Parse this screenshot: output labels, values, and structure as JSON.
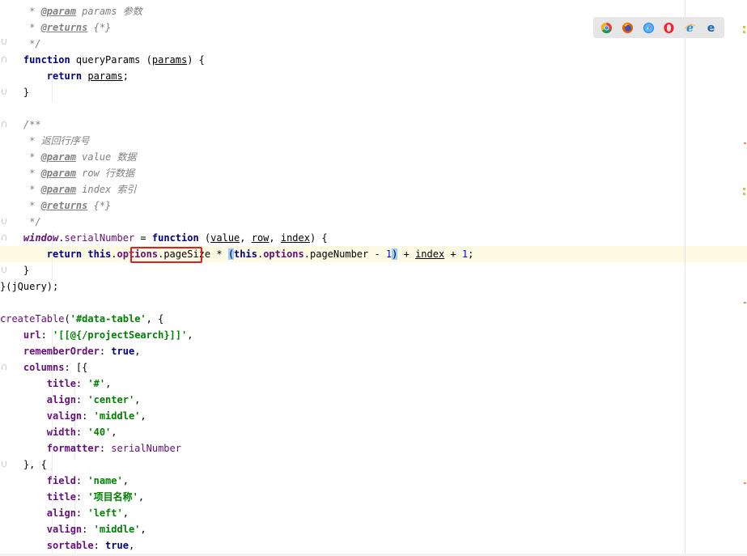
{
  "editor": {
    "lines": [
      [
        {
          "t": "     "
        },
        {
          "t": "* ",
          "c": "cmt"
        },
        {
          "t": "@param",
          "c": "tag"
        },
        {
          "t": " params 参数",
          "c": "cmt"
        }
      ],
      [
        {
          "t": "     "
        },
        {
          "t": "* ",
          "c": "cmt"
        },
        {
          "t": "@returns",
          "c": "tag"
        },
        {
          "t": " {*}",
          "c": "cmt"
        }
      ],
      [
        {
          "t": "     "
        },
        {
          "t": "*/",
          "c": "cmt"
        }
      ],
      [
        {
          "t": "    "
        },
        {
          "t": "function",
          "c": "kw"
        },
        {
          "t": " queryParams (",
          "c": "fn"
        },
        {
          "t": "params",
          "c": "ul"
        },
        {
          "t": ") {"
        }
      ],
      [
        {
          "t": "        "
        },
        {
          "t": "return",
          "c": "kw"
        },
        {
          "t": " "
        },
        {
          "t": "params",
          "c": "ul"
        },
        {
          "t": ";"
        }
      ],
      [
        {
          "t": "    }"
        }
      ],
      [
        {
          "t": ""
        }
      ],
      [
        {
          "t": "    "
        },
        {
          "t": "/**",
          "c": "cmt"
        }
      ],
      [
        {
          "t": "     "
        },
        {
          "t": "* 返回行序号",
          "c": "cmt"
        }
      ],
      [
        {
          "t": "     "
        },
        {
          "t": "* ",
          "c": "cmt"
        },
        {
          "t": "@param",
          "c": "tag"
        },
        {
          "t": " value 数据",
          "c": "cmt"
        }
      ],
      [
        {
          "t": "     "
        },
        {
          "t": "* ",
          "c": "cmt"
        },
        {
          "t": "@param",
          "c": "tag"
        },
        {
          "t": " row 行数据",
          "c": "cmt"
        }
      ],
      [
        {
          "t": "     "
        },
        {
          "t": "* ",
          "c": "cmt"
        },
        {
          "t": "@param",
          "c": "tag"
        },
        {
          "t": " index 索引",
          "c": "cmt"
        }
      ],
      [
        {
          "t": "     "
        },
        {
          "t": "* ",
          "c": "cmt"
        },
        {
          "t": "@returns",
          "c": "tag"
        },
        {
          "t": " {*}",
          "c": "cmt"
        }
      ],
      [
        {
          "t": "     "
        },
        {
          "t": "*/",
          "c": "cmt"
        }
      ],
      [
        {
          "t": "    "
        },
        {
          "t": "window",
          "c": "win"
        },
        {
          "t": "."
        },
        {
          "t": "serialNumber",
          "c": "globl"
        },
        {
          "t": " = "
        },
        {
          "t": "function",
          "c": "kw"
        },
        {
          "t": " ("
        },
        {
          "t": "value",
          "c": "ul"
        },
        {
          "t": ", "
        },
        {
          "t": "row",
          "c": "ul"
        },
        {
          "t": ", "
        },
        {
          "t": "index",
          "c": "ul"
        },
        {
          "t": ") {"
        }
      ],
      [
        {
          "t": "        "
        },
        {
          "t": "return",
          "c": "kw"
        },
        {
          "t": " "
        },
        {
          "t": "this",
          "c": "kw"
        },
        {
          "t": "."
        },
        {
          "t": "options",
          "c": "prop"
        },
        {
          "t": ".pageSize * "
        },
        {
          "t": "(",
          "c": "brace-hl"
        },
        {
          "t": "this",
          "c": "kw"
        },
        {
          "t": "."
        },
        {
          "t": "options",
          "c": "prop"
        },
        {
          "t": ".pageNumber - "
        },
        {
          "t": "1",
          "c": "num"
        },
        {
          "t": ")",
          "c": "brace-hl"
        },
        {
          "t": " + "
        },
        {
          "t": "index",
          "c": "ul"
        },
        {
          "t": " + "
        },
        {
          "t": "1",
          "c": "num"
        },
        {
          "t": ";"
        }
      ],
      [
        {
          "t": "    }"
        }
      ],
      [
        {
          "t": "}(jQuery);"
        }
      ],
      [
        {
          "t": ""
        }
      ],
      [
        {
          "t": "createTable",
          "c": "globl"
        },
        {
          "t": "("
        },
        {
          "t": "'#data-table'",
          "c": "str"
        },
        {
          "t": ", {"
        }
      ],
      [
        {
          "t": "    "
        },
        {
          "t": "url",
          "c": "prop"
        },
        {
          "t": ": "
        },
        {
          "t": "'[[@{/projectSearch}]]'",
          "c": "str"
        },
        {
          "t": ","
        }
      ],
      [
        {
          "t": "    "
        },
        {
          "t": "rememberOrder",
          "c": "prop"
        },
        {
          "t": ": "
        },
        {
          "t": "true",
          "c": "kw"
        },
        {
          "t": ","
        }
      ],
      [
        {
          "t": "    "
        },
        {
          "t": "columns",
          "c": "prop"
        },
        {
          "t": ": [{"
        }
      ],
      [
        {
          "t": "        "
        },
        {
          "t": "title",
          "c": "prop"
        },
        {
          "t": ": "
        },
        {
          "t": "'#'",
          "c": "str"
        },
        {
          "t": ","
        }
      ],
      [
        {
          "t": "        "
        },
        {
          "t": "align",
          "c": "prop"
        },
        {
          "t": ": "
        },
        {
          "t": "'center'",
          "c": "str"
        },
        {
          "t": ","
        }
      ],
      [
        {
          "t": "        "
        },
        {
          "t": "valign",
          "c": "prop"
        },
        {
          "t": ": "
        },
        {
          "t": "'middle'",
          "c": "str"
        },
        {
          "t": ","
        }
      ],
      [
        {
          "t": "        "
        },
        {
          "t": "width",
          "c": "prop"
        },
        {
          "t": ": "
        },
        {
          "t": "'40'",
          "c": "str"
        },
        {
          "t": ","
        }
      ],
      [
        {
          "t": "        "
        },
        {
          "t": "formatter",
          "c": "prop"
        },
        {
          "t": ": "
        },
        {
          "t": "serialNumber",
          "c": "globl"
        }
      ],
      [
        {
          "t": "    }, {"
        }
      ],
      [
        {
          "t": "        "
        },
        {
          "t": "field",
          "c": "prop"
        },
        {
          "t": ": "
        },
        {
          "t": "'name'",
          "c": "str"
        },
        {
          "t": ","
        }
      ],
      [
        {
          "t": "        "
        },
        {
          "t": "title",
          "c": "prop"
        },
        {
          "t": ": "
        },
        {
          "t": "'项目名称'",
          "c": "str"
        },
        {
          "t": ","
        }
      ],
      [
        {
          "t": "        "
        },
        {
          "t": "align",
          "c": "prop"
        },
        {
          "t": ": "
        },
        {
          "t": "'left'",
          "c": "str"
        },
        {
          "t": ","
        }
      ],
      [
        {
          "t": "        "
        },
        {
          "t": "valign",
          "c": "prop"
        },
        {
          "t": ": "
        },
        {
          "t": "'middle'",
          "c": "str"
        },
        {
          "t": ","
        }
      ],
      [
        {
          "t": "        "
        },
        {
          "t": "sortable",
          "c": "prop"
        },
        {
          "t": ": "
        },
        {
          "t": "true",
          "c": "kw"
        },
        {
          "t": ","
        }
      ]
    ]
  },
  "browser_icons": [
    "chrome-icon",
    "firefox-icon",
    "safari-icon",
    "opera-icon",
    "ie-icon",
    "edge-icon"
  ],
  "colors": {
    "keyword": "#000080",
    "string": "#008000",
    "comment": "#808080",
    "property": "#660e7a",
    "number": "#0000ff",
    "current_line": "#fcfae2",
    "highlight_box": "#e02020"
  }
}
